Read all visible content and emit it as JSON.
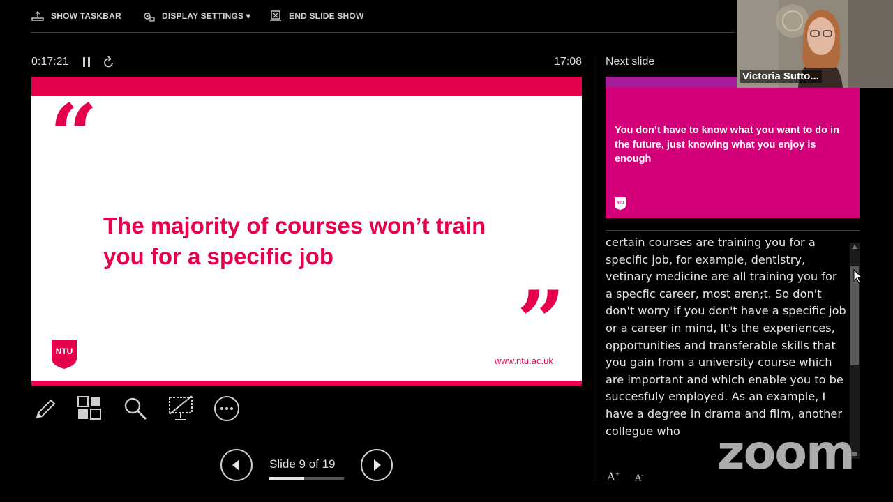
{
  "toolbar": {
    "show_taskbar": "SHOW TASKBAR",
    "display_settings": "DISPLAY SETTINGS ▾",
    "end_slide_show": "END SLIDE SHOW"
  },
  "timer": {
    "elapsed": "0:17:21",
    "clock": "17:08"
  },
  "current_slide": {
    "quote": "The majority of courses won’t train you for a specific job",
    "logo_text": "NTU",
    "url": "www.ntu.ac.uk",
    "open_quote": "“",
    "close_quote": "”"
  },
  "navigation": {
    "counter": "Slide 9 of 19",
    "progress": 0.47
  },
  "next_slide": {
    "label": "Next slide",
    "text": "You don’t have to know what you want to do in the future, just knowing what you enjoy is enough",
    "logo_text": "NTU"
  },
  "notes": {
    "text": "certain courses are training you for a specific job, for example, dentistry, vetinary medicine are all training you for a specfic career, most aren;t. So don't don't worry if you don't have a specific job or a career in mind, It's the experiences, opportunities and transferable skills that you gain from a university course which are important and which enable you to be succesfuly employed. As an example, I have a degree in drama and film, another collegue who"
  },
  "font_controls": {
    "increase": "A",
    "decrease": "A"
  },
  "webcam": {
    "participant_name": "Victoria Sutto..."
  },
  "watermark": "zoom",
  "colors": {
    "brand": "#e6004c",
    "next_slide_bg": "#d4007a"
  }
}
